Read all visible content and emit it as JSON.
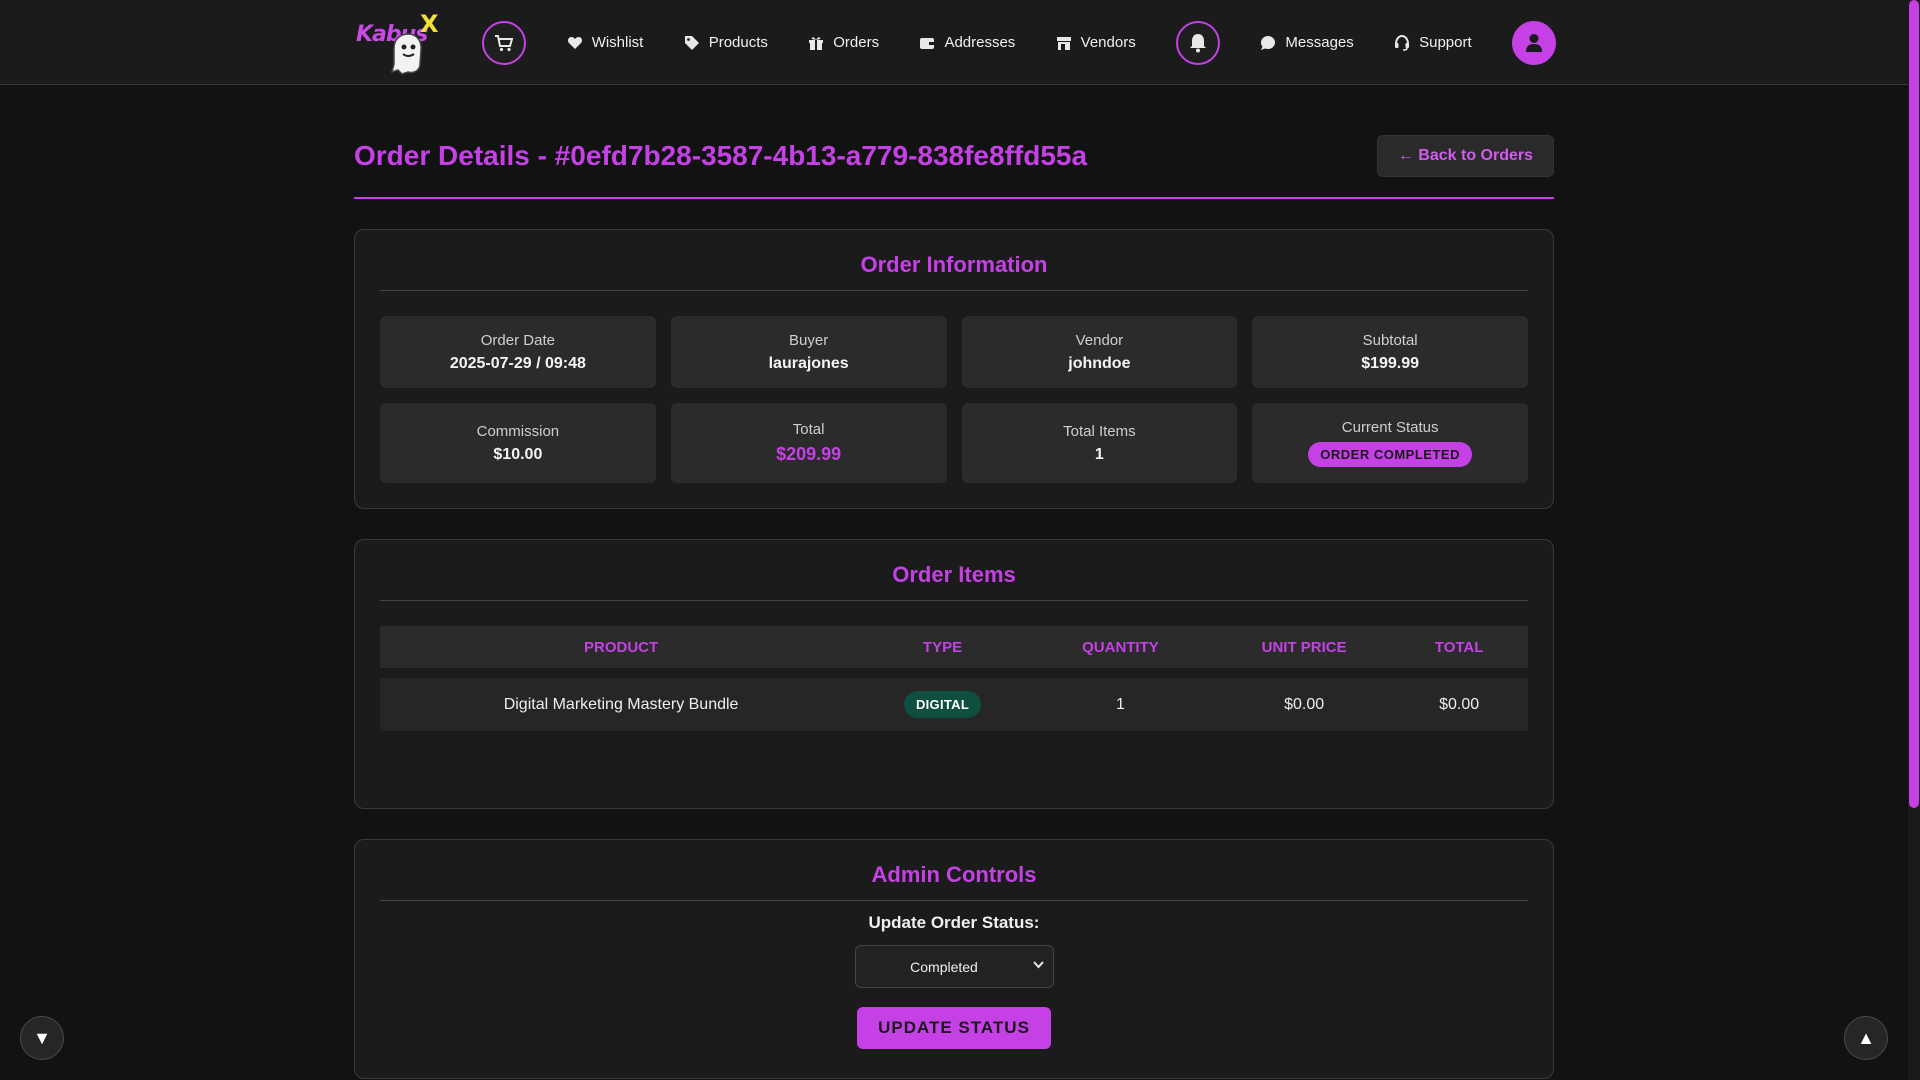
{
  "nav": {
    "logo_text": "Kabus",
    "logo_x": "X",
    "links": [
      {
        "label": "Wishlist",
        "icon": "heart-icon"
      },
      {
        "label": "Products",
        "icon": "tag-icon"
      },
      {
        "label": "Orders",
        "icon": "gift-icon"
      },
      {
        "label": "Addresses",
        "icon": "wallet-icon"
      },
      {
        "label": "Vendors",
        "icon": "store-icon"
      },
      {
        "label": "Messages",
        "icon": "chat-icon"
      },
      {
        "label": "Support",
        "icon": "headset-icon"
      }
    ]
  },
  "page": {
    "title": "Order Details - #0efd7b28-3587-4b13-a779-838fe8ffd55a",
    "back_label": "← Back to Orders"
  },
  "order_info": {
    "title": "Order Information",
    "fields": [
      {
        "label": "Order Date",
        "value": "2025-07-29 / 09:48"
      },
      {
        "label": "Buyer",
        "value": "laurajones"
      },
      {
        "label": "Vendor",
        "value": "johndoe"
      },
      {
        "label": "Subtotal",
        "value": "$199.99"
      },
      {
        "label": "Commission",
        "value": "$10.00"
      },
      {
        "label": "Total",
        "value": "$209.99"
      },
      {
        "label": "Total Items",
        "value": "1"
      },
      {
        "label": "Current Status",
        "value": "ORDER COMPLETED"
      }
    ]
  },
  "order_items": {
    "title": "Order Items",
    "headers": [
      "PRODUCT",
      "TYPE",
      "QUANTITY",
      "UNIT PRICE",
      "TOTAL"
    ],
    "rows": [
      {
        "product": "Digital Marketing Mastery Bundle",
        "type": "DIGITAL",
        "quantity": "1",
        "unit_price": "$0.00",
        "total": "$0.00"
      }
    ]
  },
  "admin": {
    "title": "Admin Controls",
    "status_label": "Update Order Status:",
    "selected_status": "Completed",
    "update_label": "UPDATE STATUS"
  },
  "colors": {
    "accent": "#c541e6",
    "background": "#121212",
    "digital_badge": "#0f4f3f"
  },
  "floating": {
    "down_symbol": "▼",
    "up_symbol": "▲"
  }
}
